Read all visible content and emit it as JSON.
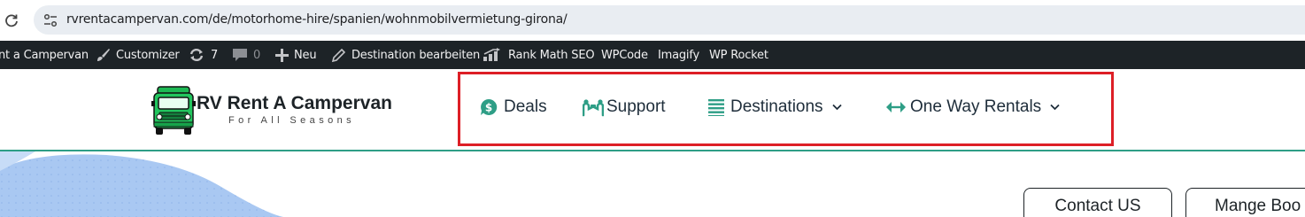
{
  "browser": {
    "url": "rvrentacampervan.com/de/motorhome-hire/spanien/wohnmobilvermietung-girona/",
    "icons": [
      "reload-icon",
      "site-info-icon"
    ]
  },
  "admin_bar": {
    "site_name": "nt a Campervan",
    "customizer": "Customizer",
    "updates_count": "7",
    "comments_count": "0",
    "new": "Neu",
    "edit": "Destination bearbeiten",
    "rank_math": "Rank Math SEO",
    "wpcode": "WPCode",
    "imagify": "Imagify",
    "wp_rocket": "WP Rocket"
  },
  "header": {
    "logo_title": "RV Rent A Campervan",
    "logo_tagline": "For All Seasons",
    "nav": [
      {
        "label": "Deals",
        "icon": "dollar-chat-icon"
      },
      {
        "label": "Support",
        "icon": "support-people-icon"
      },
      {
        "label": "Destinations",
        "icon": "list-icon",
        "has_dropdown": true
      },
      {
        "label": "One Way Rentals",
        "icon": "double-arrow-icon",
        "has_dropdown": true
      }
    ],
    "accent_color": "#2e9e86",
    "highlight_color": "#dd1f26"
  },
  "hero": {
    "contact_button": "Contact US",
    "manage_button": "Mange Boo"
  }
}
